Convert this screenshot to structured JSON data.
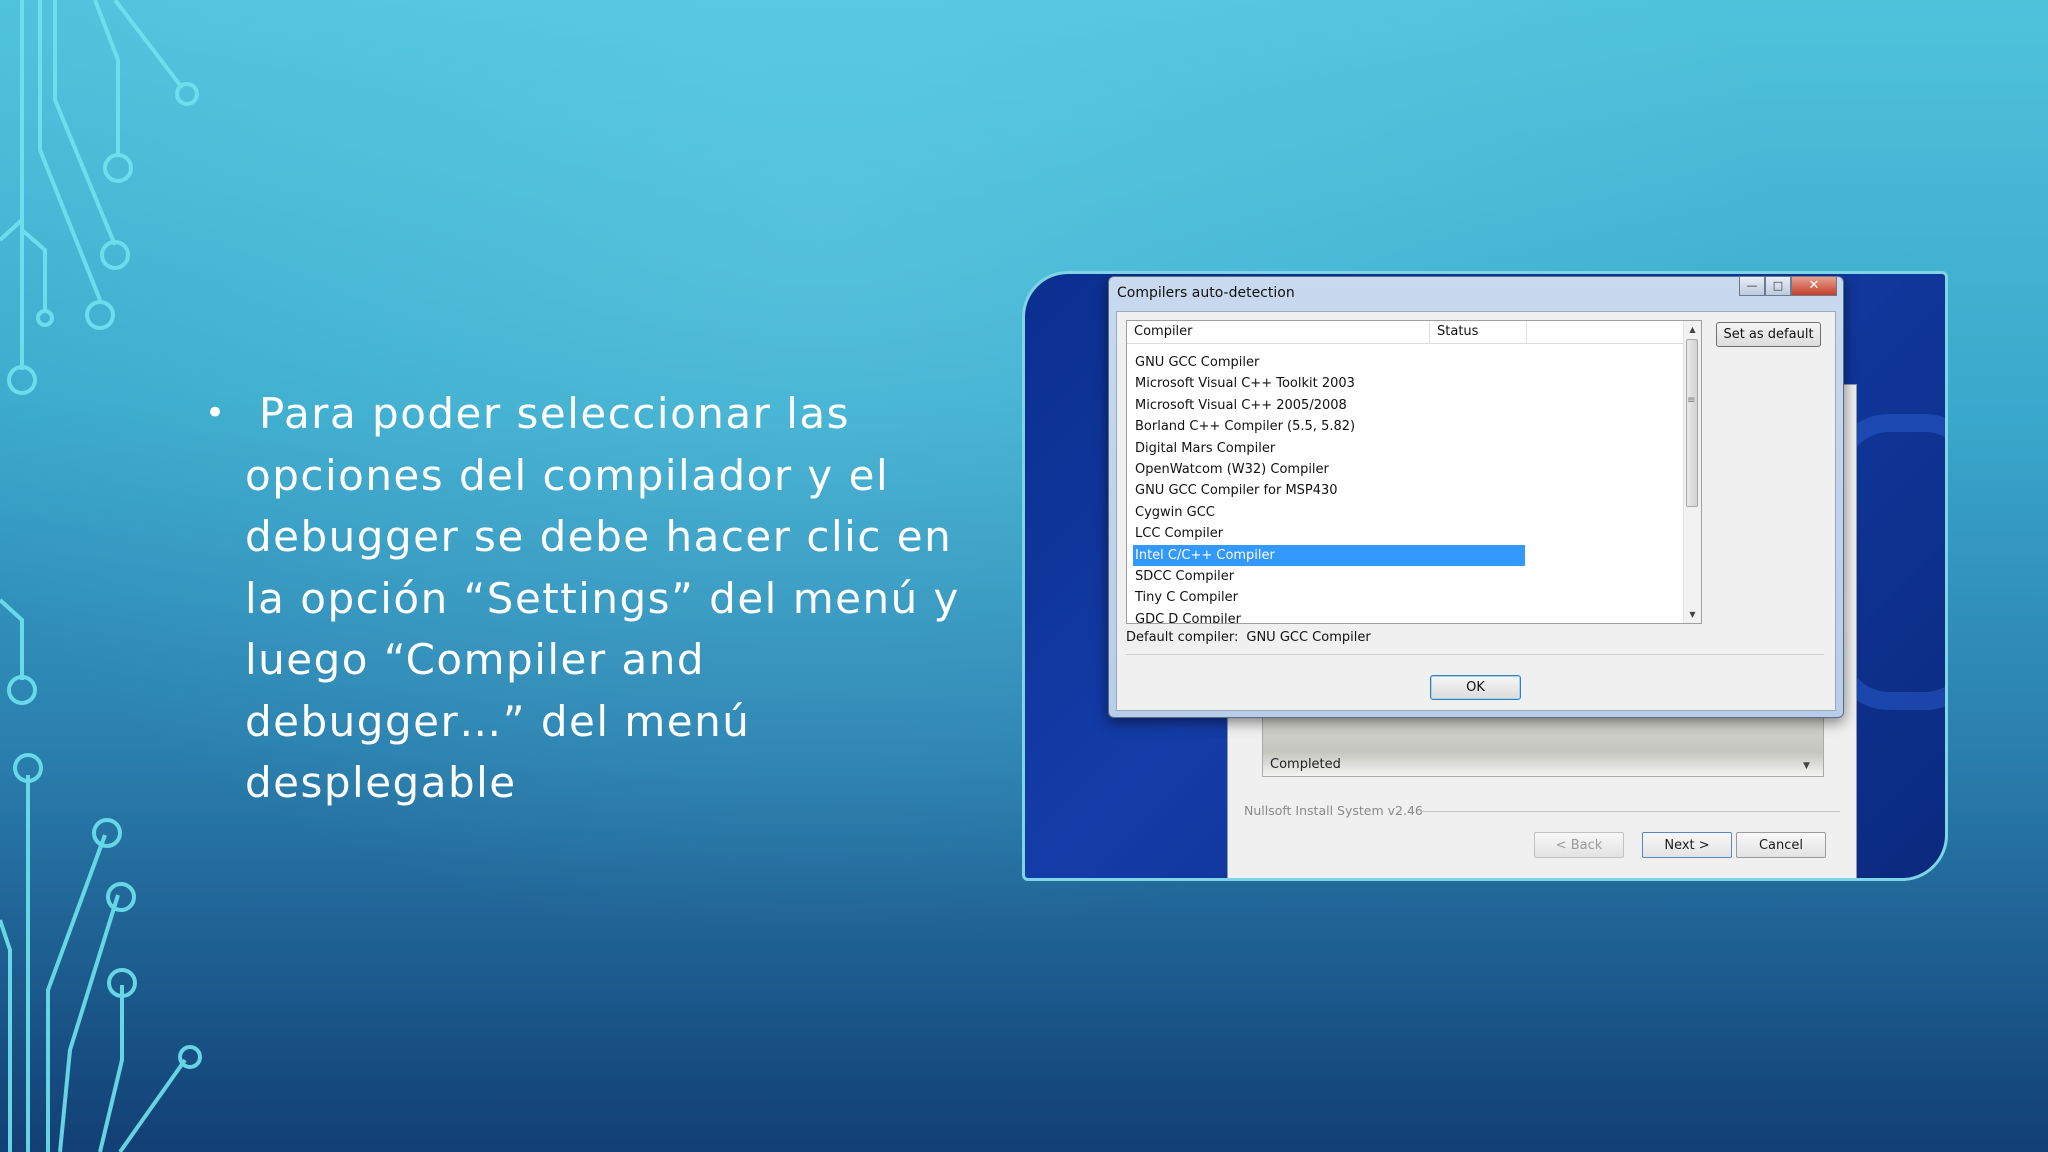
{
  "slide": {
    "bullet_lines": [
      "Para poder seleccionar las",
      "opciones del compilador y el",
      "debugger se debe hacer clic en",
      "la opción “Settings” del menú y",
      "luego “Compiler and",
      "debugger…” del menú",
      "desplegable"
    ]
  },
  "dialog": {
    "title": "Compilers auto-detection",
    "columns": [
      "Compiler",
      "Status"
    ],
    "compilers": [
      "GNU GCC Compiler",
      "Microsoft Visual C++ Toolkit 2003",
      "Microsoft Visual C++ 2005/2008",
      "Borland C++ Compiler (5.5, 5.82)",
      "Digital Mars Compiler",
      "OpenWatcom (W32) Compiler",
      "GNU GCC Compiler for MSP430",
      "Cygwin GCC",
      "LCC Compiler",
      "Intel C/C++ Compiler",
      "SDCC Compiler",
      "Tiny C Compiler",
      "GDC D Compiler"
    ],
    "selected_index": 9,
    "set_default_label": "Set as default",
    "default_compiler_label": "Default compiler:",
    "default_compiler_value": "GNU GCC Compiler",
    "ok_label": "OK"
  },
  "installer": {
    "completed_label": "Completed",
    "nsis_label": "Nullsoft Install System v2.46",
    "back_label": "< Back",
    "next_label": "Next >",
    "cancel_label": "Cancel"
  },
  "colors": {
    "selection": "#3399ff",
    "circuit": "#6fe3ef"
  },
  "icons": [
    "minimize-icon",
    "maximize-icon",
    "close-icon",
    "scroll-up-icon",
    "scroll-down-icon",
    "bullet-icon"
  ]
}
